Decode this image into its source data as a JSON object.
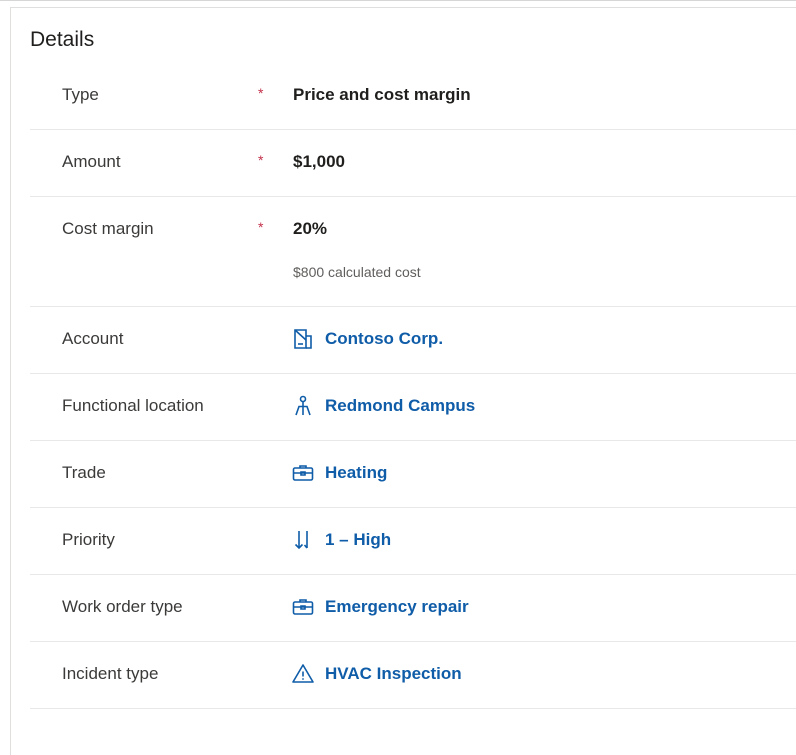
{
  "section": {
    "title": "Details"
  },
  "fields": {
    "type": {
      "label": "Type",
      "required": "*",
      "value": "Price and cost margin"
    },
    "amount": {
      "label": "Amount",
      "required": "*",
      "value": "$1,000"
    },
    "cost_margin": {
      "label": "Cost margin",
      "required": "*",
      "value": "20%",
      "hint": "$800 calculated cost"
    },
    "account": {
      "label": "Account",
      "value": "Contoso Corp.",
      "icon": "building-icon"
    },
    "functional_location": {
      "label": "Functional location",
      "value": "Redmond Campus",
      "icon": "location-hierarchy-icon"
    },
    "trade": {
      "label": "Trade",
      "value": "Heating",
      "icon": "toolbox-icon"
    },
    "priority": {
      "label": "Priority",
      "value": "1 – High",
      "icon": "sort-priority-icon"
    },
    "work_order_type": {
      "label": "Work order type",
      "value": "Emergency repair",
      "icon": "toolbox-icon"
    },
    "incident_type": {
      "label": "Incident type",
      "value": "HVAC Inspection",
      "icon": "warning-icon"
    }
  },
  "colors": {
    "link": "#0f5ca8",
    "required": "#c4314b",
    "divider": "#e8e8e8"
  }
}
